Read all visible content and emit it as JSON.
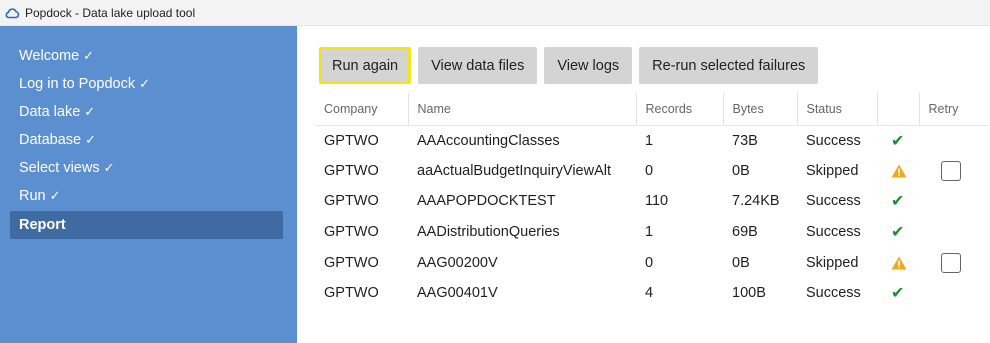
{
  "window": {
    "title": "Popdock - Data lake upload tool"
  },
  "sidebar": {
    "items": [
      {
        "label": "Welcome",
        "check": "✓"
      },
      {
        "label": "Log in to Popdock",
        "check": "✓"
      },
      {
        "label": "Data lake",
        "check": "✓"
      },
      {
        "label": "Database",
        "check": "✓"
      },
      {
        "label": "Select views",
        "check": "✓"
      },
      {
        "label": "Run",
        "check": "✓"
      },
      {
        "label": "Report",
        "check": ""
      }
    ],
    "active_index": 6
  },
  "toolbar": {
    "run_again": "Run again",
    "view_data_files": "View data files",
    "view_logs": "View logs",
    "rerun_failures": "Re-run selected failures"
  },
  "table": {
    "headers": {
      "company": "Company",
      "name": "Name",
      "records": "Records",
      "bytes": "Bytes",
      "status": "Status",
      "icon": "",
      "retry": "Retry"
    },
    "rows": [
      {
        "company": "GPTWO",
        "name": "AAAccountingClasses",
        "records": "1",
        "bytes": "73B",
        "status": "Success"
      },
      {
        "company": "GPTWO",
        "name": "aaActualBudgetInquiryViewAlt",
        "records": "0",
        "bytes": "0B",
        "status": "Skipped"
      },
      {
        "company": "GPTWO",
        "name": "AAAPOPDOCKTEST",
        "records": "110",
        "bytes": "7.24KB",
        "status": "Success"
      },
      {
        "company": "GPTWO",
        "name": "AADistributionQueries",
        "records": "1",
        "bytes": "69B",
        "status": "Success"
      },
      {
        "company": "GPTWO",
        "name": "AAG00200V",
        "records": "0",
        "bytes": "0B",
        "status": "Skipped"
      },
      {
        "company": "GPTWO",
        "name": "AAG00401V",
        "records": "4",
        "bytes": "100B",
        "status": "Success"
      }
    ]
  },
  "colors": {
    "sidebar": "#5b8fcf",
    "sidebar_active": "#3f6aa2",
    "focus_border": "#f0e61c",
    "success": "#1e8f2e",
    "warning": "#f0a91c"
  },
  "icons": {
    "success": "check-icon",
    "skipped": "warning-icon",
    "app": "cloud-icon"
  }
}
